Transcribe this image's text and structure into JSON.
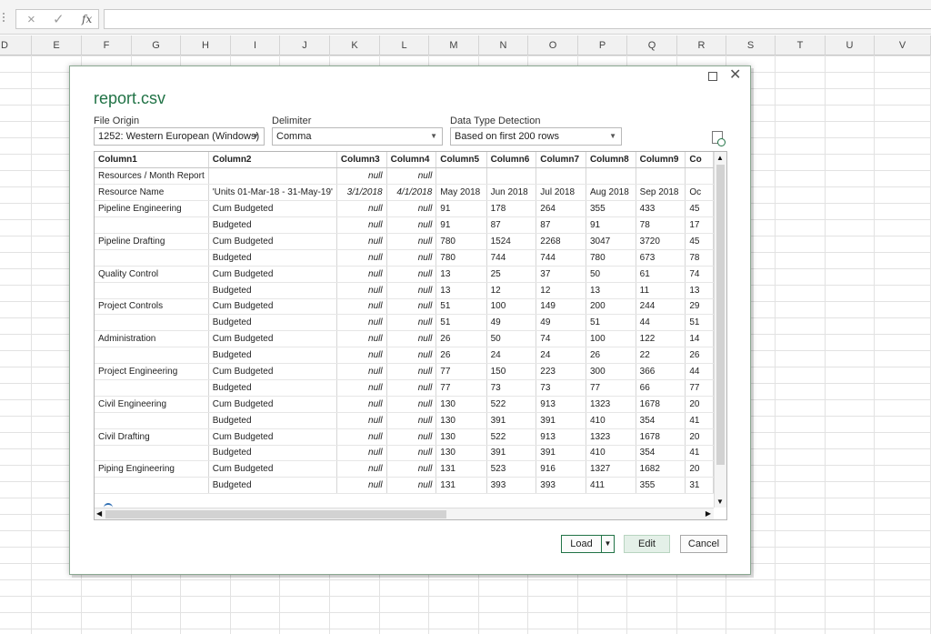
{
  "formula_bar": {
    "cancel_icon": "×",
    "enter_icon": "✓",
    "fx_label": "fx",
    "value": ""
  },
  "sheet": {
    "columns": [
      "D",
      "E",
      "F",
      "G",
      "H",
      "I",
      "J",
      "K",
      "L",
      "M",
      "N",
      "O",
      "P",
      "Q",
      "R",
      "S",
      "T",
      "U",
      "V"
    ]
  },
  "dialog": {
    "title": "report.csv",
    "file_origin": {
      "label": "File Origin",
      "value": "1252: Western European (Windows)"
    },
    "delimiter": {
      "label": "Delimiter",
      "value": "Comma"
    },
    "data_type_detection": {
      "label": "Data Type Detection",
      "value": "Based on first 200 rows"
    },
    "table": {
      "headers": [
        "Column1",
        "Column2",
        "Column3",
        "Column4",
        "Column5",
        "Column6",
        "Column7",
        "Column8",
        "Column9",
        "Co"
      ],
      "rows": [
        [
          "Resources / Month Report",
          "",
          "null",
          "null",
          "",
          "",
          "",
          "",
          "",
          ""
        ],
        [
          "Resource Name",
          "'Units 01-Mar-18 - 31-May-19'",
          "3/1/2018",
          "4/1/2018",
          "May 2018",
          "Jun 2018",
          "Jul 2018",
          "Aug 2018",
          "Sep 2018",
          "Oc"
        ],
        [
          "Pipeline Engineering",
          "Cum Budgeted",
          "null",
          "null",
          "91",
          "178",
          "264",
          "355",
          "433",
          "45"
        ],
        [
          "",
          "Budgeted",
          "null",
          "null",
          "91",
          "87",
          "87",
          "91",
          "78",
          "17"
        ],
        [
          "Pipeline Drafting",
          "Cum Budgeted",
          "null",
          "null",
          "780",
          "1524",
          "2268",
          "3047",
          "3720",
          "45"
        ],
        [
          "",
          "Budgeted",
          "null",
          "null",
          "780",
          "744",
          "744",
          "780",
          "673",
          "78"
        ],
        [
          "Quality Control",
          "Cum Budgeted",
          "null",
          "null",
          "13",
          "25",
          "37",
          "50",
          "61",
          "74"
        ],
        [
          "",
          "Budgeted",
          "null",
          "null",
          "13",
          "12",
          "12",
          "13",
          "11",
          "13"
        ],
        [
          "Project Controls",
          "Cum Budgeted",
          "null",
          "null",
          "51",
          "100",
          "149",
          "200",
          "244",
          "29"
        ],
        [
          "",
          "Budgeted",
          "null",
          "null",
          "51",
          "49",
          "49",
          "51",
          "44",
          "51"
        ],
        [
          "Administration",
          "Cum Budgeted",
          "null",
          "null",
          "26",
          "50",
          "74",
          "100",
          "122",
          "14"
        ],
        [
          "",
          "Budgeted",
          "null",
          "null",
          "26",
          "24",
          "24",
          "26",
          "22",
          "26"
        ],
        [
          "Project Engineering",
          "Cum Budgeted",
          "null",
          "null",
          "77",
          "150",
          "223",
          "300",
          "366",
          "44"
        ],
        [
          "",
          "Budgeted",
          "null",
          "null",
          "77",
          "73",
          "73",
          "77",
          "66",
          "77"
        ],
        [
          "Civil Engineering",
          "Cum Budgeted",
          "null",
          "null",
          "130",
          "522",
          "913",
          "1323",
          "1678",
          "20"
        ],
        [
          "",
          "Budgeted",
          "null",
          "null",
          "130",
          "391",
          "391",
          "410",
          "354",
          "41"
        ],
        [
          "Civil Drafting",
          "Cum Budgeted",
          "null",
          "null",
          "130",
          "522",
          "913",
          "1323",
          "1678",
          "20"
        ],
        [
          "",
          "Budgeted",
          "null",
          "null",
          "130",
          "391",
          "391",
          "410",
          "354",
          "41"
        ],
        [
          "Piping Engineering",
          "Cum Budgeted",
          "null",
          "null",
          "131",
          "523",
          "916",
          "1327",
          "1682",
          "20"
        ],
        [
          "",
          "Budgeted",
          "null",
          "null",
          "131",
          "393",
          "393",
          "411",
          "355",
          "31"
        ]
      ]
    },
    "buttons": {
      "load": "Load",
      "load_arrow": "▼",
      "edit": "Edit",
      "cancel": "Cancel"
    }
  }
}
